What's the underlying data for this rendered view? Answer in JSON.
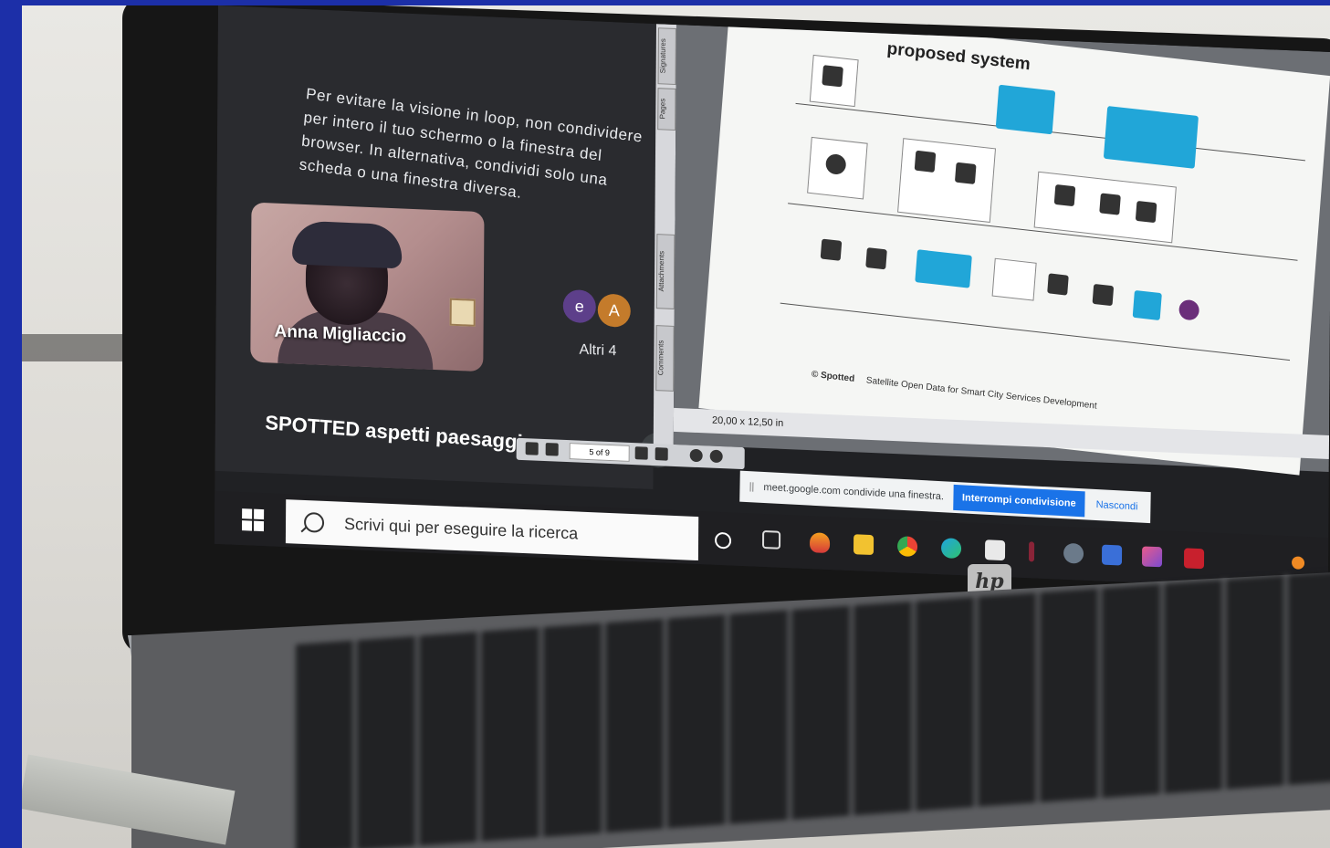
{
  "meet": {
    "notice": "Per evitare la visione in loop, non condividere per intero il tuo schermo o la finestra del browser. In alternativa, condividi solo una scheda o una finestra diversa.",
    "participant_name": "Anna Migliaccio",
    "avatars": [
      "e",
      "A"
    ],
    "others_label": "Altri 4",
    "meeting_title": "SPOTTED aspetti paesaggio"
  },
  "pdf_viewer": {
    "side_tabs": [
      "Signatures",
      "Pages",
      "Attachments",
      "Comments"
    ],
    "slide_title": "proposed system",
    "slide_footer_brand": "© Spotted",
    "slide_footer_text": "Satellite Open Data for Smart City Services Development",
    "page_size": "20,00 x 12,50 in",
    "page_indicator": "5 of 9"
  },
  "share_banner": {
    "text": "meet.google.com condivide una finestra.",
    "stop_button": "Interrompi condivisione",
    "hide_button": "Nascondi"
  },
  "taskbar": {
    "search_placeholder": "Scrivi qui per eseguire la ricerca"
  },
  "colors": {
    "page_background": "#1c2fa8",
    "meet_panel": "#2a2b2f",
    "share_stop": "#1a73e8",
    "diagram_accent": "#21a6d8"
  }
}
